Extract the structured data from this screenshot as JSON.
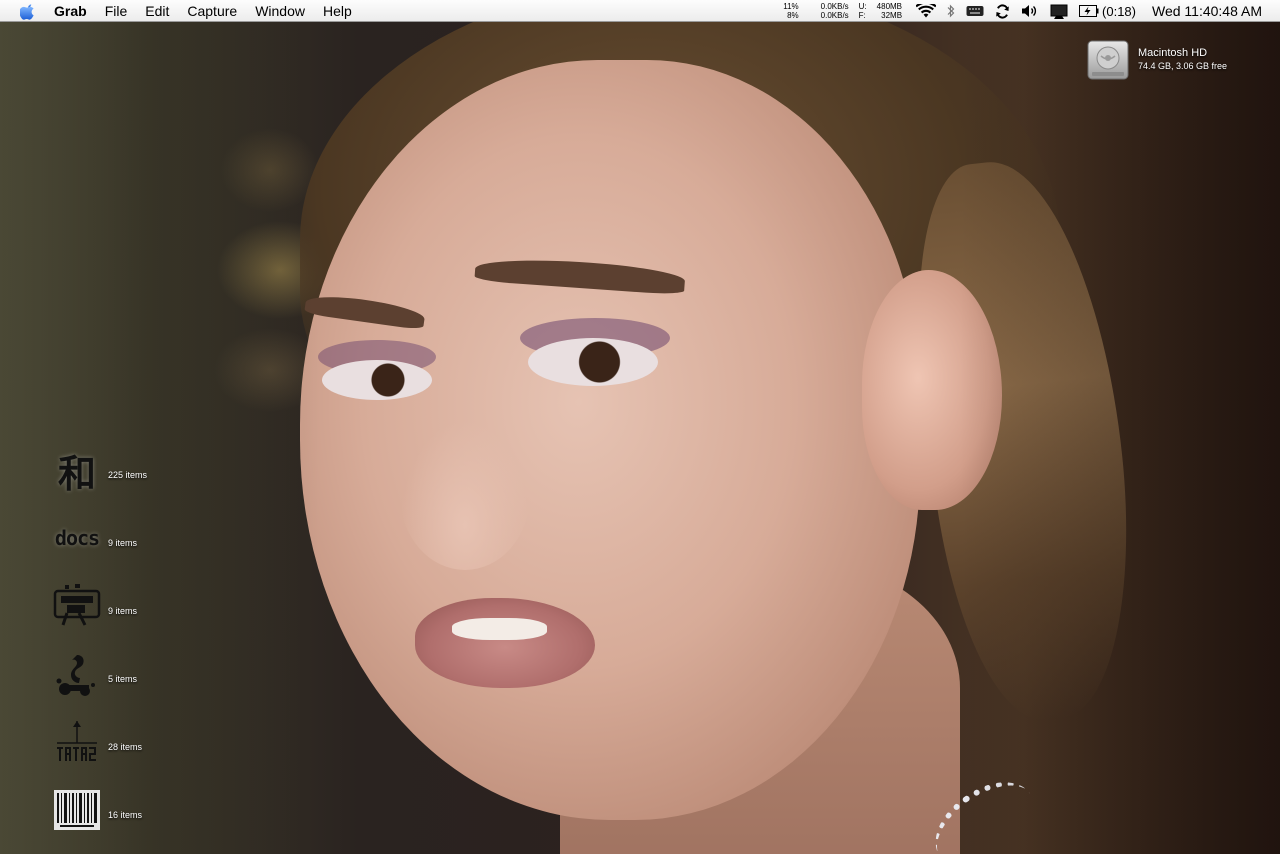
{
  "menubar": {
    "app_name": "Grab",
    "menus": [
      "File",
      "Edit",
      "Capture",
      "Window",
      "Help"
    ],
    "cpu_top": "11%",
    "cpu_bottom": "8%",
    "net_up": "0.0KB/s",
    "net_down": "0.0KB/s",
    "mem_u_label": "U:",
    "mem_u_value": "480MB",
    "mem_f_label": "F:",
    "mem_f_value": "32MB",
    "battery_time": "(0:18)",
    "clock": "Wed 11:40:48 AM",
    "status_icons": [
      "wifi-icon",
      "bluetooth-icon",
      "keyboard-icon",
      "sync-icon",
      "volume-icon",
      "display-icon",
      "battery-icon"
    ]
  },
  "desktop": {
    "hard_drive": {
      "name": "Macintosh HD",
      "info": "74.4 GB, 3.06 GB free"
    },
    "folders": [
      {
        "glyph": "和",
        "count": "225 items"
      },
      {
        "glyph": "docs",
        "count": "9 items"
      },
      {
        "glyph": "",
        "count": "9 items"
      },
      {
        "glyph": "",
        "count": "5 items"
      },
      {
        "glyph": "",
        "count": "28 items"
      },
      {
        "glyph": "",
        "count": "16 items"
      }
    ]
  }
}
